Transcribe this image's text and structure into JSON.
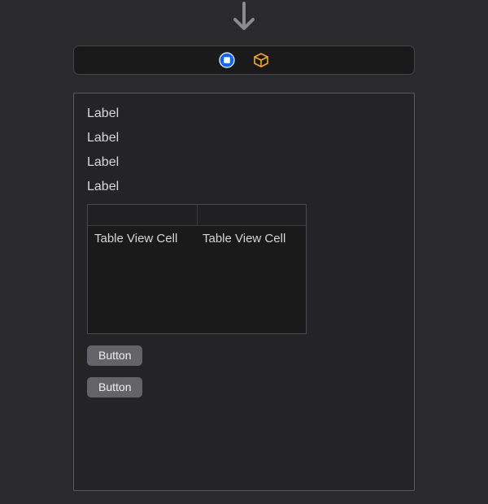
{
  "labels": [
    "Label",
    "Label",
    "Label",
    "Label"
  ],
  "table": {
    "cells": [
      "Table View Cell",
      "Table View Cell"
    ]
  },
  "buttons": [
    "Button",
    "Button"
  ],
  "colors": {
    "stop_icon_bg": "#0a66ff",
    "package_icon": "#f5a623"
  }
}
